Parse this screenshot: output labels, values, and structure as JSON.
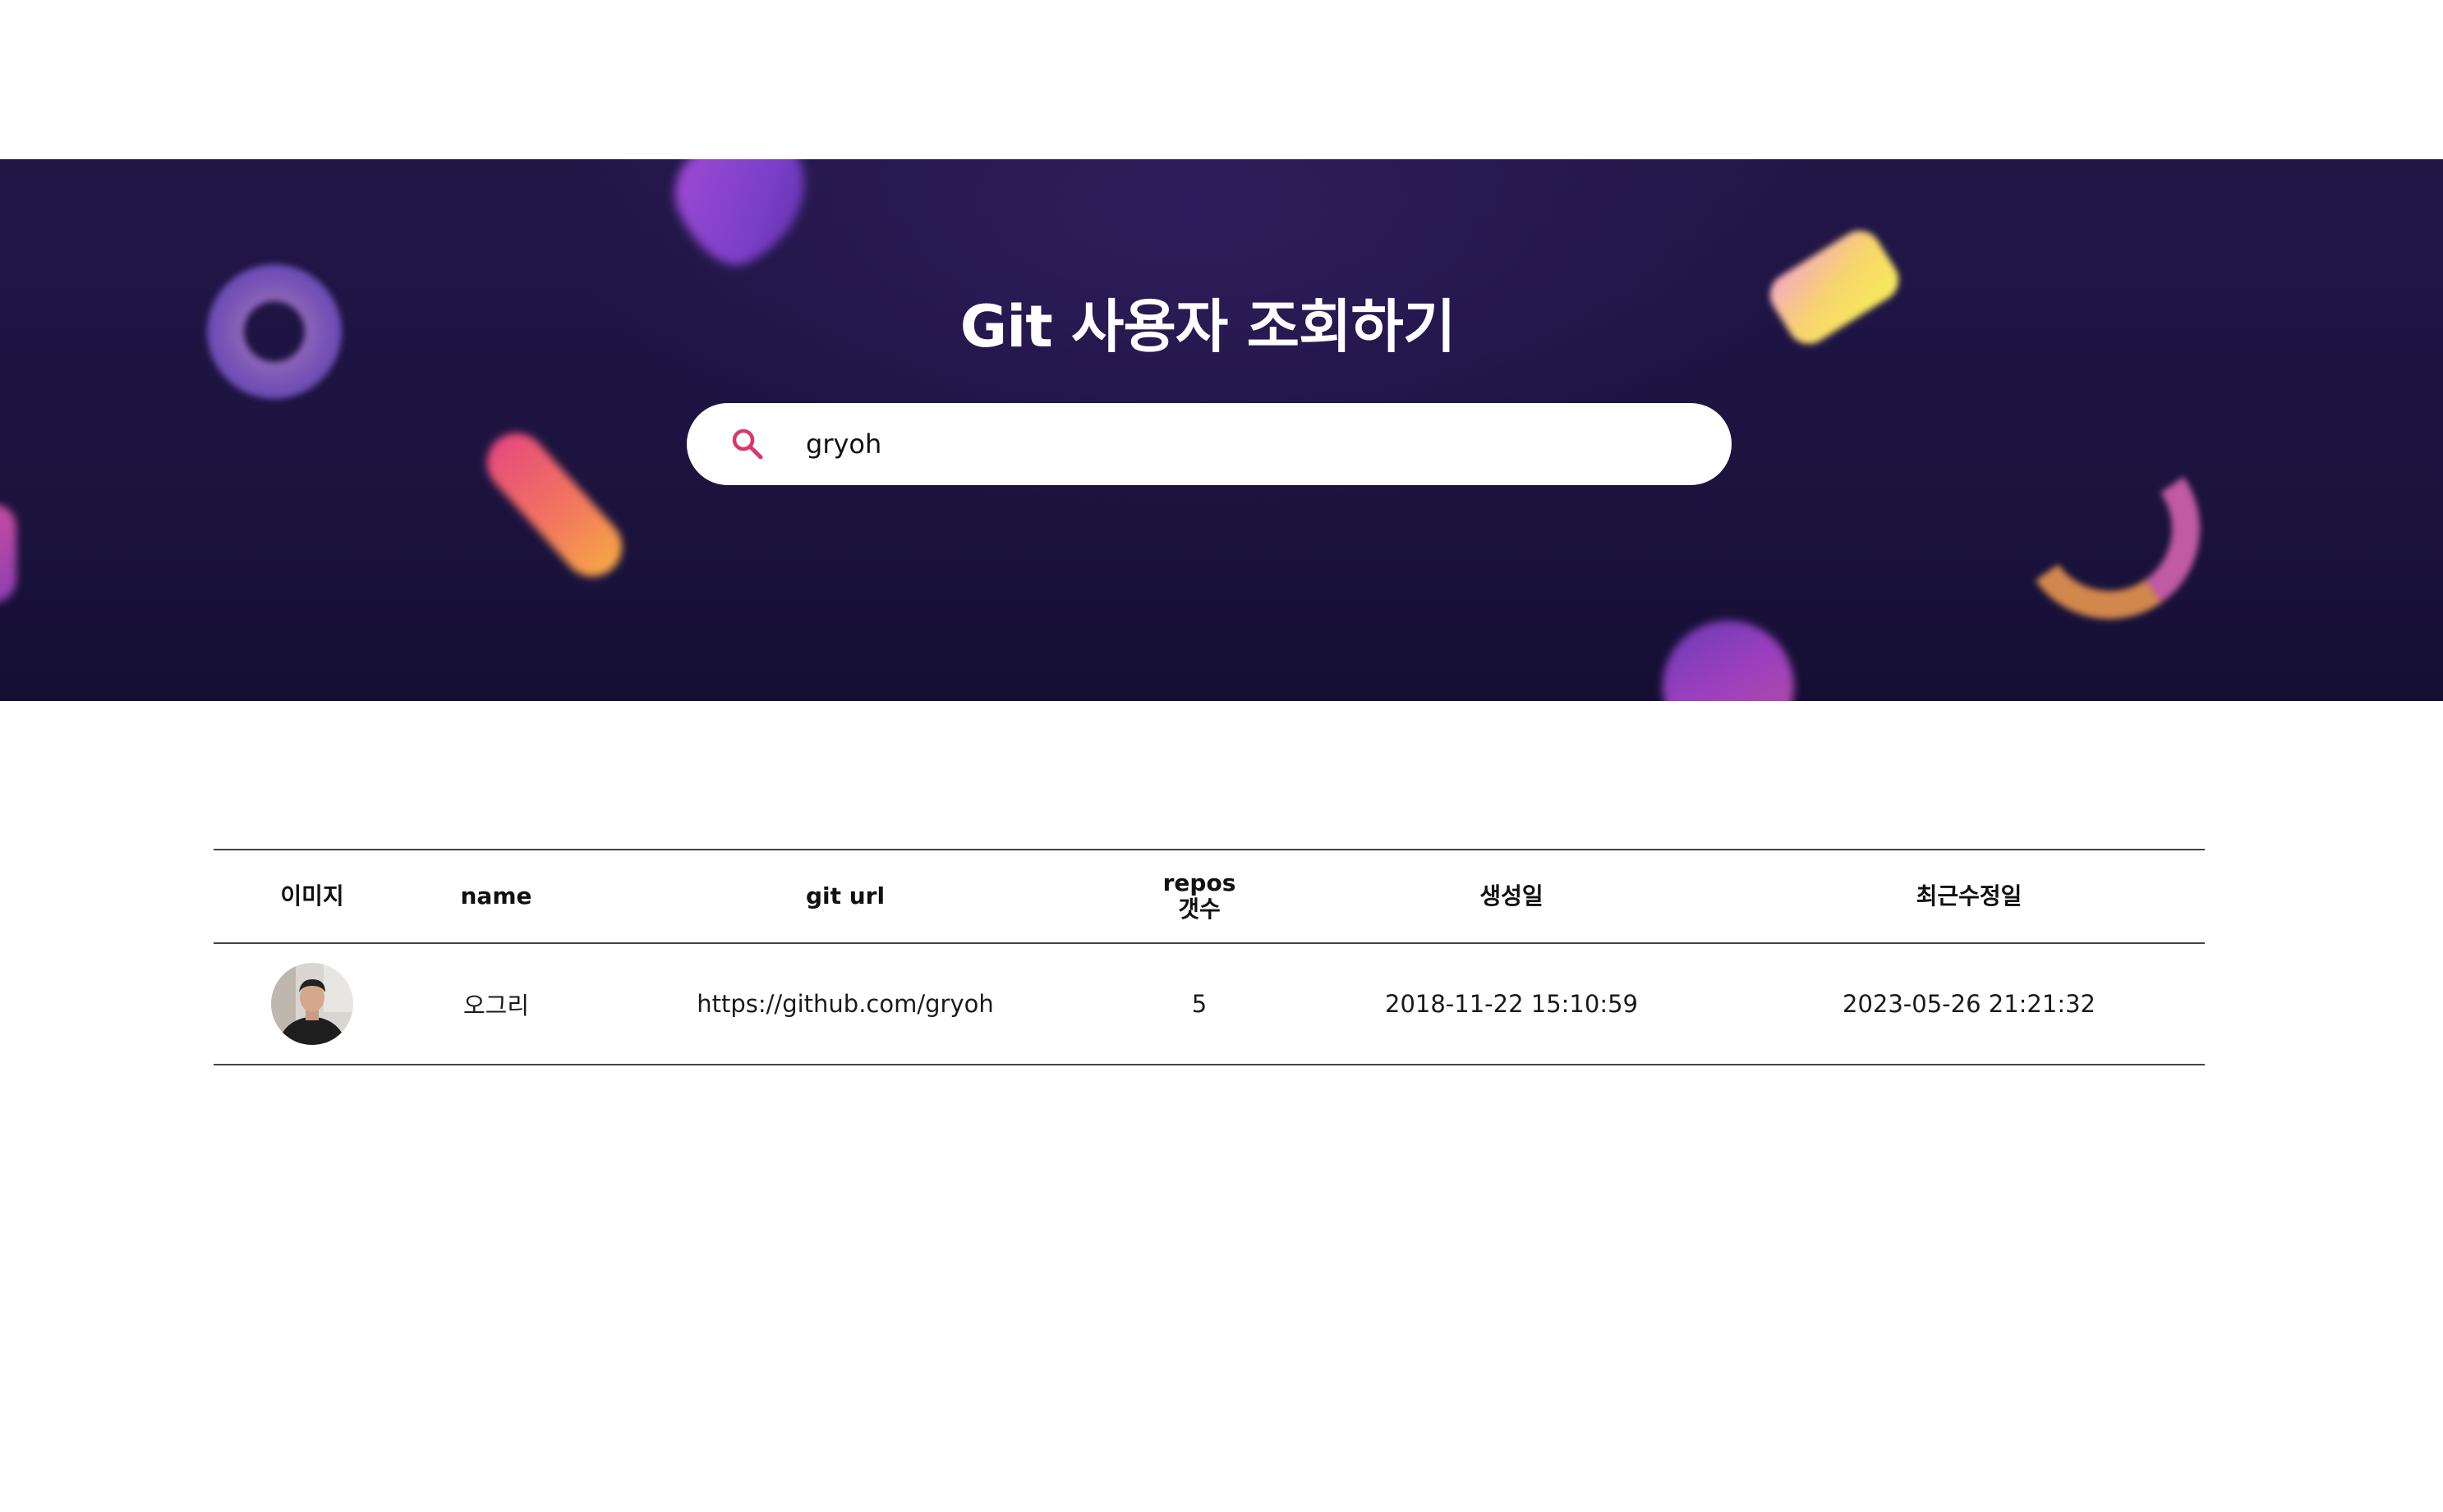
{
  "hero": {
    "title": "Git 사용자 조회하기"
  },
  "search": {
    "value": "gryoh",
    "icon": "search-icon",
    "icon_color": "#d9376e"
  },
  "table": {
    "headers": {
      "image": "이미지",
      "name": "name",
      "git_url": "git url",
      "repos_line1": "repos",
      "repos_line2": "갯수",
      "created": "생성일",
      "updated": "최근수정일"
    },
    "rows": [
      {
        "avatar": "user-avatar",
        "name": "오그리",
        "git_url": "https://github.com/gryoh",
        "repos": "5",
        "created": "2018-11-22 15:10:59",
        "updated": "2023-05-26 21:21:32"
      }
    ]
  },
  "colors": {
    "hero_background": "#1c1340",
    "accent": "#d9376e",
    "table_border": "#444444"
  }
}
